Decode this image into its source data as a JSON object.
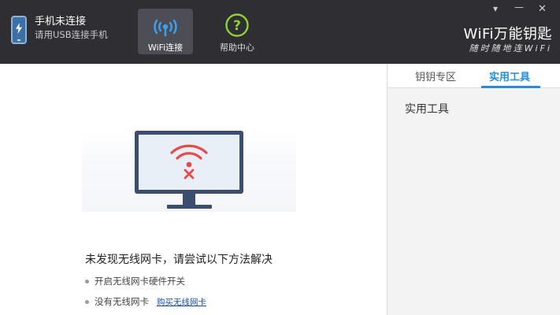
{
  "header": {
    "phone_status": {
      "title": "手机未连接",
      "subtitle": "请用USB连接手机"
    },
    "tabs": [
      {
        "label": "WiFi连接",
        "icon": "wifi-icon",
        "active": true
      },
      {
        "label": "帮助中心",
        "icon": "help-icon",
        "active": false
      }
    ],
    "window_controls": {
      "menu": "▾",
      "minimize": "—",
      "close": "✕"
    },
    "brand": {
      "logo": "WiFi万能钥匙",
      "slogan": "随时随地连WiFi"
    }
  },
  "main": {
    "illustration_icon": "monitor-no-wifi-icon",
    "message": "未发现无线网卡，请尝试以下方法解决",
    "tips": [
      {
        "text": "开启无线网卡硬件开关"
      },
      {
        "text": "没有无线网卡",
        "link": "购买无线网卡"
      }
    ]
  },
  "sidebar": {
    "tabs": [
      {
        "label": "钥钥专区",
        "active": false
      },
      {
        "label": "实用工具",
        "active": true
      }
    ],
    "content_title": "实用工具"
  },
  "colors": {
    "topbar_bg": "#2e2e33",
    "accent_blue": "#1f8fe0",
    "wifi_red": "#e84a4a",
    "help_green": "#8fd13b",
    "monitor_frame": "#3b4e6e"
  }
}
